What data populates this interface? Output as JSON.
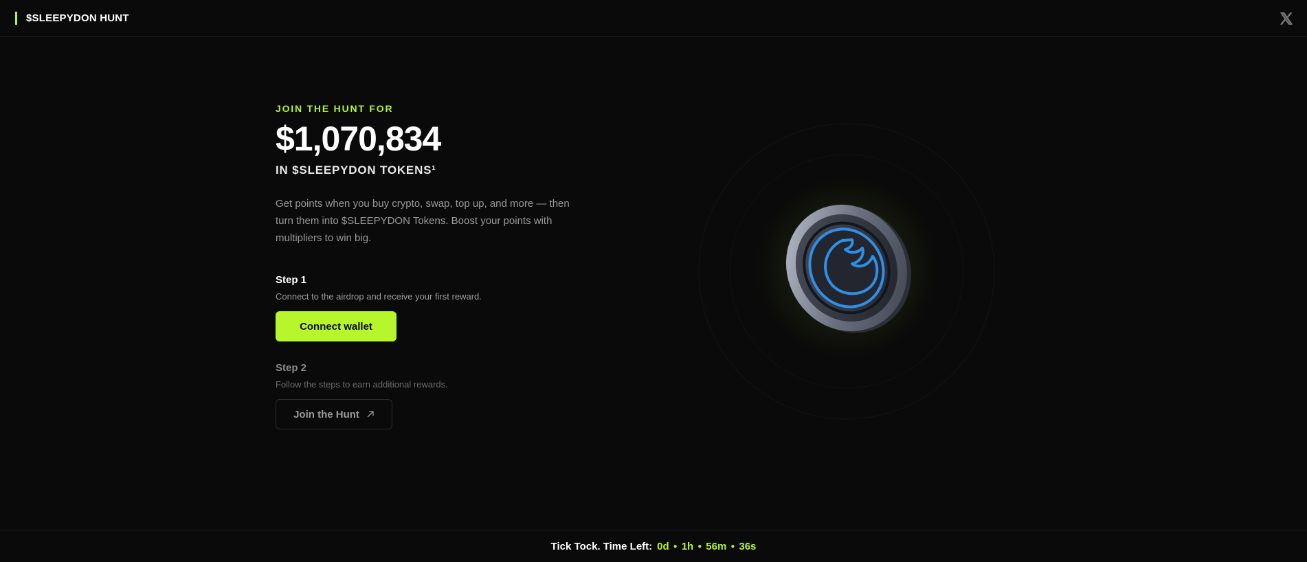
{
  "header": {
    "brand": "$SLEEPYDON HUNT",
    "social_icon": "x-logo-icon"
  },
  "hero": {
    "eyebrow": "JOIN THE HUNT FOR",
    "amount": "$1,070,834",
    "token_line": "IN $SLEEPYDON TOKENS¹",
    "description": "Get points when you buy crypto, swap, top up, and more — then turn them into $SLEEPYDON Tokens. Boost your points with multipliers to win big."
  },
  "steps": [
    {
      "title": "Step 1",
      "description": "Connect to the airdrop and receive your first reward.",
      "button": "Connect wallet"
    },
    {
      "title": "Step 2",
      "description": "Follow the steps to earn additional rewards.",
      "button": "Join the Hunt"
    }
  ],
  "footer": {
    "label": "Tick Tock. Time Left:",
    "days": "0d",
    "hours": "1h",
    "minutes": "56m",
    "seconds": "36s"
  },
  "colors": {
    "accent": "#b7f62b",
    "background": "#0a0a0a",
    "coin_blue": "#2f8fe8"
  }
}
